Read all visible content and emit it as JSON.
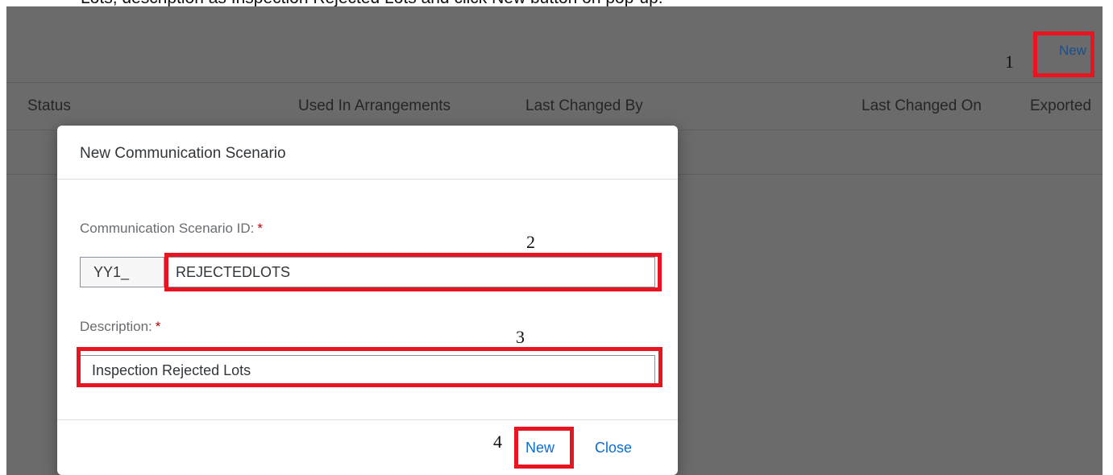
{
  "caption": {
    "text_before": "Lots, description as Inspection Rejected Lots and click New button on pop-up."
  },
  "toolbar": {
    "new_label": "New"
  },
  "table": {
    "columns": [
      "Status",
      "Used In Arrangements",
      "Last Changed By",
      "Last Changed On",
      "Exported"
    ]
  },
  "dialog": {
    "title": "New Communication Scenario",
    "scenario_id_label": "Communication Scenario ID:",
    "required_marker": "*",
    "scenario_id_prefix": "YY1_",
    "scenario_id_value": "REJECTEDLOTS",
    "description_label": "Description:",
    "description_value": "Inspection Rejected Lots",
    "new_label": "New",
    "close_label": "Close"
  },
  "annotations": {
    "callout_1": "1",
    "callout_2": "2",
    "callout_3": "3",
    "callout_4": "4",
    "callout_color": "#e8141f"
  }
}
